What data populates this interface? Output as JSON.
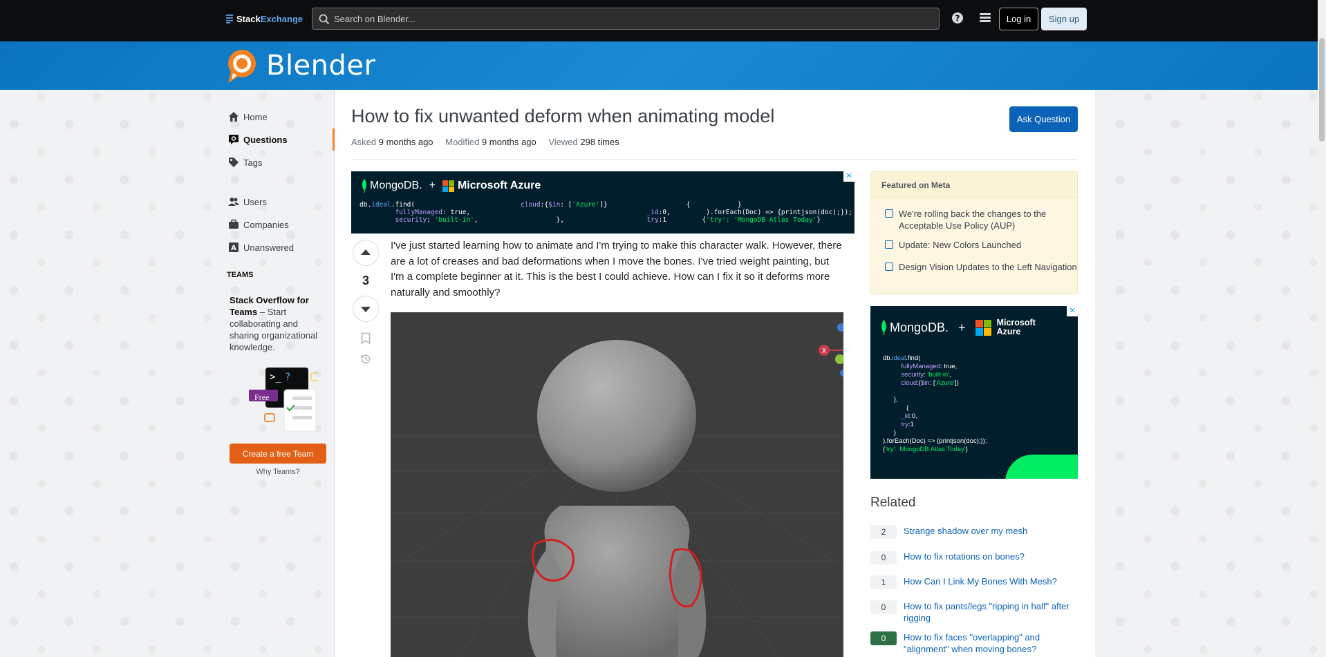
{
  "topbar": {
    "logo_stack": "Stack",
    "logo_exchange": "Exchange",
    "search_placeholder": "Search on Blender...",
    "login": "Log in",
    "signup": "Sign up"
  },
  "banner": {
    "site_name": "Blender"
  },
  "leftnav": {
    "items": [
      {
        "label": "Home",
        "icon": "home-icon"
      },
      {
        "label": "Questions",
        "icon": "questions-icon",
        "active": true
      },
      {
        "label": "Tags",
        "icon": "tag-icon"
      },
      {
        "label": "Users",
        "icon": "users-icon"
      },
      {
        "label": "Companies",
        "icon": "briefcase-icon"
      },
      {
        "label": "Unanswered",
        "icon": "unanswered-icon"
      }
    ],
    "teams_heading": "TEAMS",
    "teams_title": "Stack Overflow for Teams",
    "teams_text": " – Start collaborating and sharing organizational knowledge.",
    "free_badge": "Free",
    "create_team": "Create a free Team",
    "why_teams": "Why Teams?"
  },
  "question": {
    "title": "How to fix unwanted deform when animating model",
    "ask_button": "Ask Question",
    "asked_label": "Asked",
    "asked_value": "9 months ago",
    "modified_label": "Modified",
    "modified_value": "9 months ago",
    "viewed_label": "Viewed",
    "viewed_value": "298 times",
    "votes": "3",
    "body": "I've just started learning how to animate and I'm trying to make this character walk. However, there are a lot of creases and bad deformations when I move the bones. I've tried weight painting, but I'm a complete beginner at it. This is the best I could achieve. How can I fix it so it deforms more naturally and smoothly?"
  },
  "ad": {
    "brand": "MongoDB.",
    "plus": "+",
    "partner": "Microsoft Azure",
    "partner_line1": "Microsoft",
    "partner_line2": "Azure",
    "close": "✕"
  },
  "featured": {
    "heading": "Featured on Meta",
    "items": [
      "We're rolling back the changes to the Acceptable Use Policy (AUP)",
      "Update: New Colors Launched",
      "Design Vision Updates to the Left Navigation"
    ]
  },
  "related": {
    "heading": "Related",
    "items": [
      {
        "score": "2",
        "title": "Strange shadow over my mesh",
        "answered": false
      },
      {
        "score": "0",
        "title": "How to fix rotations on bones?",
        "answered": false
      },
      {
        "score": "1",
        "title": "How Can I Link My Bones With Mesh?",
        "answered": false
      },
      {
        "score": "0",
        "title": "How to fix pants/legs \"ripping in half\" after rigging",
        "answered": false
      },
      {
        "score": "0",
        "title": "How to fix faces \"overlapping\" and \"alignment\" when moving bones?",
        "answered": true
      }
    ]
  },
  "colors": {
    "accent": "#0a63b8",
    "brand_orange": "#f48225",
    "banner": "#0b74c0"
  }
}
